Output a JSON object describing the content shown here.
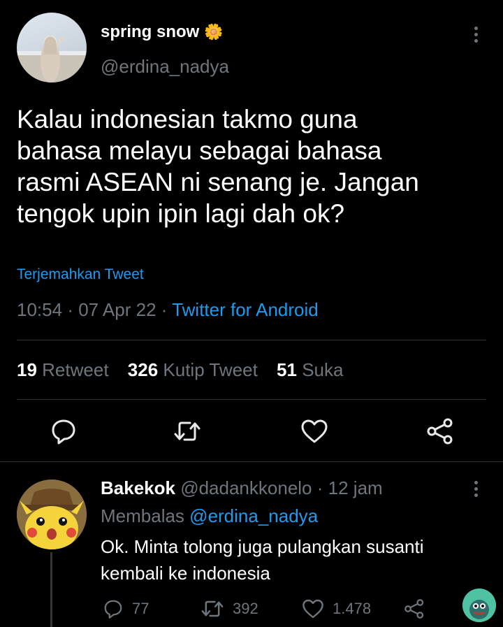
{
  "tweet": {
    "author_name": "spring snow",
    "author_emoji": "🌼",
    "author_handle": "@erdina_nadya",
    "text_lines": [
      "Kalau indonesian takmo guna",
      "bahasa melayu sebagai bahasa",
      "rasmi ASEAN ni senang je. Jangan",
      "tengok upin ipin lagi dah ok?"
    ],
    "translate_label": "Terjemahkan Tweet",
    "time": "10:54",
    "date": "07 Apr 22",
    "sep": "·",
    "source": "Twitter for Android",
    "retweet_count": "19",
    "retweet_label": "Retweet",
    "quote_count": "326",
    "quote_label": "Kutip Tweet",
    "like_count": "51",
    "like_label": "Suka",
    "icons": [
      "reply-icon",
      "retweet-icon",
      "like-icon",
      "share-icon",
      "more-icon"
    ]
  },
  "reply": {
    "author_name": "Bakekok",
    "author_handle": "@dadankkonelo",
    "sep": "·",
    "time": "12 jam",
    "replying_label": "Membalas",
    "replying_to": "@erdina_nadya",
    "text_lines": [
      "Ok. Minta tolong juga pulangkan susanti",
      "kembali ke indonesia"
    ],
    "reply_count": "77",
    "retweet_count": "392",
    "like_count": "1.478"
  },
  "colors": {
    "background": "#000000",
    "text": "#e7e9ea",
    "muted": "#6e767d",
    "link": "#1d9bf0",
    "divider": "#2f3336"
  }
}
